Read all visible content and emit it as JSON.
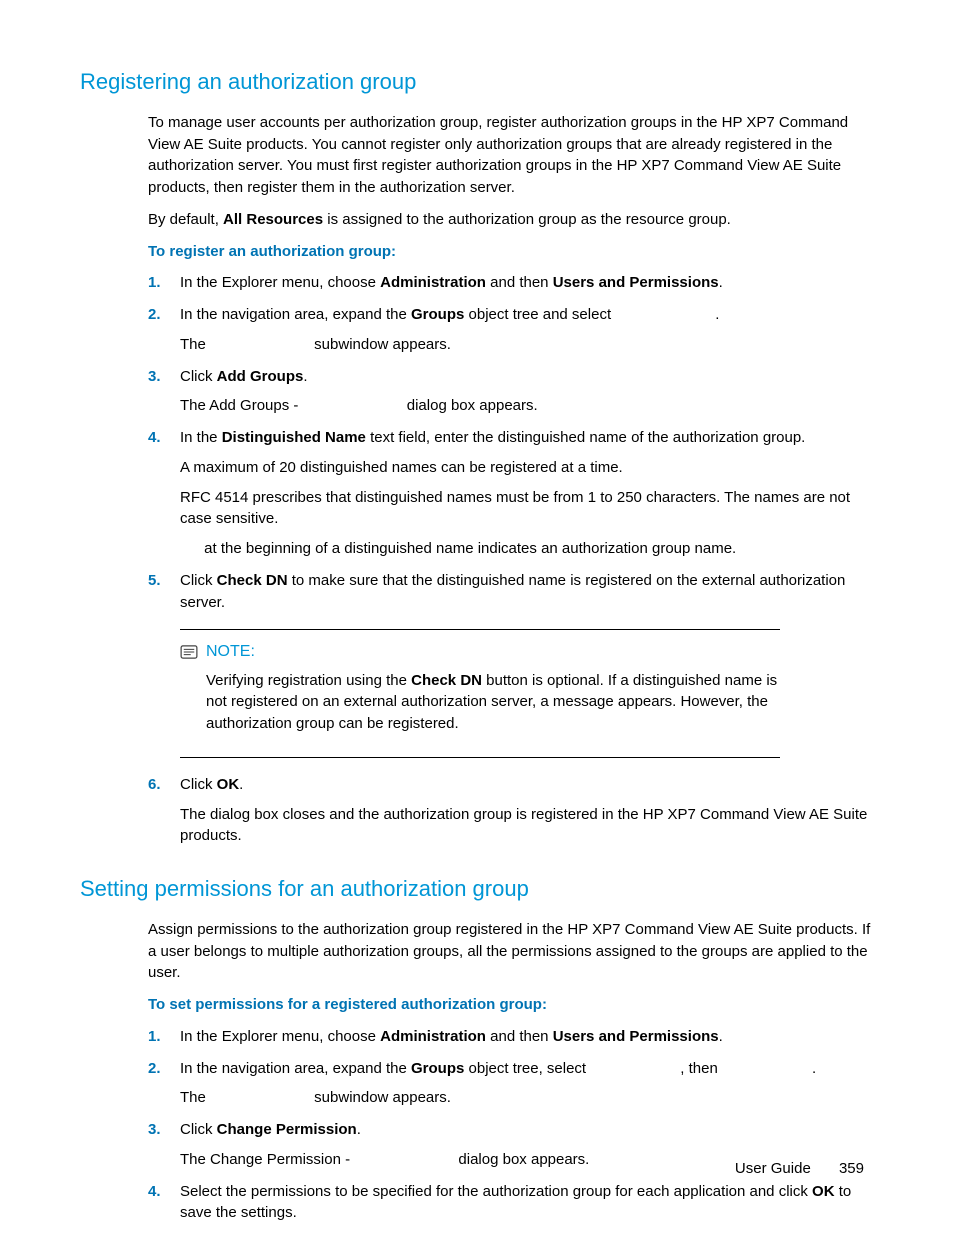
{
  "section1": {
    "heading": "Registering an authorization group",
    "intro": "To manage user accounts per authorization group, register authorization groups in the HP XP7 Command View AE Suite products. You cannot register only authorization groups that are already registered in the authorization server. You must first register authorization groups in the HP XP7 Command View AE Suite products, then register them in the authorization server.",
    "default_pre": "By default, ",
    "default_bold": "All Resources",
    "default_post": " is assigned to the authorization group as the resource group.",
    "sub": "To register an authorization group:",
    "steps": {
      "s1_pre": "In the Explorer menu, choose ",
      "s1_b1": "Administration",
      "s1_mid": " and then ",
      "s1_b2": "Users and Permissions",
      "s1_post": ".",
      "s2_pre": "In the navigation area, expand the ",
      "s2_b": "Groups",
      "s2_mid": " object tree and select ",
      "s2_post": ".",
      "s2_sub_pre": "The ",
      "s2_sub_post": " subwindow appears.",
      "s3_pre": "Click ",
      "s3_b": "Add Groups",
      "s3_post": ".",
      "s3_sub_pre": "The Add Groups - ",
      "s3_sub_post": " dialog box appears.",
      "s4_pre": "In the ",
      "s4_b": "Distinguished Name",
      "s4_post": " text field, enter the distinguished name of the authorization group.",
      "s4_p2": "A maximum of 20 distinguished names can be registered at a time.",
      "s4_p3": "RFC 4514 prescribes that distinguished names must be from 1 to 250 characters. The names are not case sensitive.",
      "s4_p4": " at the beginning of a distinguished name indicates an authorization group name.",
      "s5_pre": "Click ",
      "s5_b": "Check DN",
      "s5_post": " to make sure that the distinguished name is registered on the external authorization server.",
      "s6_pre": "Click ",
      "s6_b": "OK",
      "s6_post": ".",
      "s6_p2": "The dialog box closes and the authorization group is registered in the HP XP7 Command View AE Suite products."
    },
    "note": {
      "label": "NOTE:",
      "body_pre": "Verifying registration using the ",
      "body_b": "Check DN",
      "body_post": " button is optional. If a distinguished name is not registered on an external authorization server, a message appears. However, the authorization group can be registered."
    }
  },
  "section2": {
    "heading": "Setting permissions for an authorization group",
    "intro": "Assign permissions to the authorization group registered in the HP XP7 Command View AE Suite products. If a user belongs to multiple authorization groups, all the permissions assigned to the groups are applied to the user.",
    "sub": "To set permissions for a registered authorization group:",
    "steps": {
      "s1_pre": "In the Explorer menu, choose ",
      "s1_b1": "Administration",
      "s1_mid": " and then ",
      "s1_b2": "Users and Permissions",
      "s1_post": ".",
      "s2_pre": "In the navigation area, expand the ",
      "s2_b": "Groups",
      "s2_mid": " object tree, select ",
      "s2_mid2": ", then ",
      "s2_post": ".",
      "s2_sub_pre": "The ",
      "s2_sub_post": " subwindow appears.",
      "s3_pre": "Click ",
      "s3_b": "Change Permission",
      "s3_post": ".",
      "s3_sub_pre": "The Change Permission - ",
      "s3_sub_post": " dialog box appears.",
      "s4_pre": "Select the permissions to be specified for the authorization group for each application and click ",
      "s4_b": "OK",
      "s4_post": " to save the settings."
    }
  },
  "footer": {
    "label": "User Guide",
    "page": "359"
  }
}
